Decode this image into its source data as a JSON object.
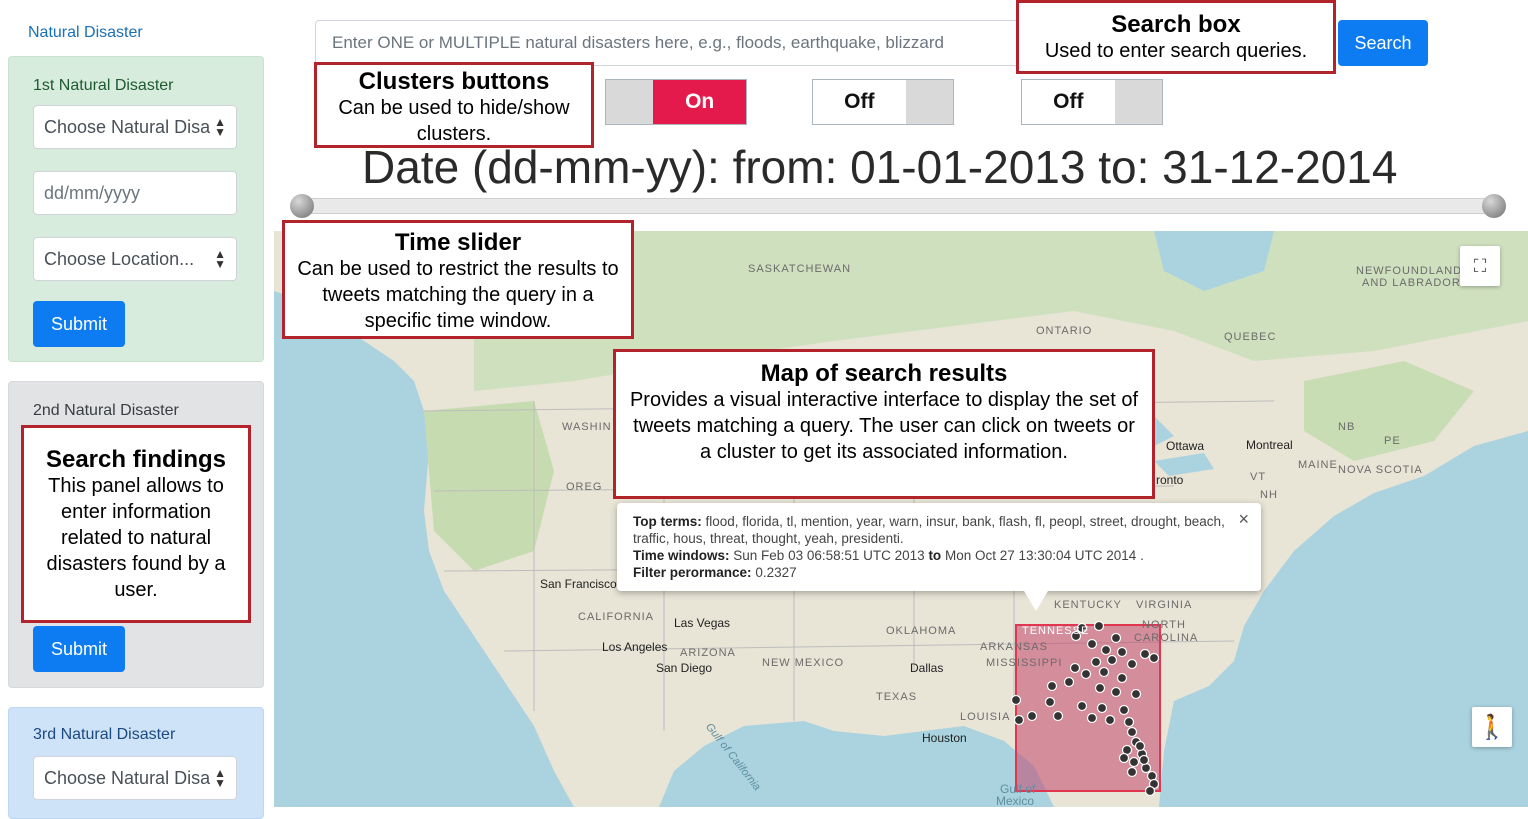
{
  "sidebar": {
    "title": "Natural Disaster",
    "panel1": {
      "title": "1st Natural Disaster",
      "disaster_select": "Choose Natural Disa",
      "date_placeholder": "dd/mm/yyyy",
      "location_select": "Choose Location...",
      "submit": "Submit"
    },
    "panel2": {
      "title": "2nd Natural Disaster",
      "submit": "Submit"
    },
    "panel3": {
      "title": "3rd Natural Disaster",
      "disaster_select": "Choose Natural Disa"
    }
  },
  "search": {
    "placeholder": "Enter ONE or MULTIPLE natural disasters here, e.g., floods, earthquake, blizzard",
    "button": "Search"
  },
  "toggles": [
    {
      "label": "On",
      "state": "on"
    },
    {
      "label": "Off",
      "state": "off"
    },
    {
      "label": "Off",
      "state": "off"
    }
  ],
  "date_range": {
    "text": "Date (dd-mm-yy): from: 01-01-2013 to: 31-12-2014"
  },
  "map": {
    "labels": {
      "saskatchewan": "SASKATCHEWAN",
      "newfoundland1": "NEWFOUNDLAND",
      "newfoundland2": "AND LABRADOR",
      "ontario": "ONTARIO",
      "quebec": "QUEBEC",
      "washington": "WASHIN",
      "oregon": "OREG",
      "ottawa": "Ottawa",
      "montreal": "Montreal",
      "nb": "NB",
      "pe": "PE",
      "maine": "MAINE",
      "vt": "VT",
      "nh": "NH",
      "nova_scotia": "NOVA SCOTIA",
      "toronto": "ronto",
      "san_francisco": "San Francisco",
      "california": "CALIFORNIA",
      "las_vegas": "Las Vegas",
      "los_angeles": "Los Angeles",
      "arizona": "ARIZONA",
      "san_diego": "San Diego",
      "new_mexico": "NEW MEXICO",
      "oklahoma": "OKLAHOMA",
      "dallas": "Dallas",
      "texas": "TEXAS",
      "houston": "Houston",
      "arkansas": "ARKANSAS",
      "mississippi": "MISSISSIPPI",
      "louisiana": "LOUISIA",
      "kentucky": "KENTUCKY",
      "virginia": "VIRGINIA",
      "tennessee": "TENNESSE",
      "north": "NORTH",
      "carolina": "CAROLINA",
      "gulf_california": "Gulf of California",
      "gulf_mexico1": "Gulf of",
      "gulf_mexico2": "Mexico"
    },
    "fullscreen_icon": "fullscreen-icon",
    "pegman_icon": "pegman-icon"
  },
  "info_window": {
    "top_terms_label": "Top terms:",
    "top_terms": "flood, florida, tl, mention, year, warn, insur, bank, flash, fl, peopl, street, drought, beach, traffic, hous, threat, thought, yeah, presidenti.",
    "time_label": "Time windows:",
    "time_from": "Sun Feb 03 06:58:51 UTC 2013",
    "time_to_word": "to",
    "time_to": "Mon Oct 27 13:30:04 UTC 2014 .",
    "filter_label": "Filter perormance:",
    "filter_value": "0.2327",
    "close": "×"
  },
  "annotations": {
    "search_box": {
      "title": "Search box",
      "desc": "Used to enter search queries."
    },
    "clusters": {
      "title": "Clusters buttons",
      "desc": "Can be used to hide/show clusters."
    },
    "time_slider": {
      "title": "Time slider",
      "desc": "Can be used to restrict the results to tweets matching the query in a specific time window."
    },
    "map_results": {
      "title": "Map of search results",
      "desc": "Provides a visual interactive interface to display the set of tweets matching a query. The user can click on tweets or a cluster to get its associated information."
    },
    "search_findings": {
      "title": "Search findings",
      "desc": "This panel allows to enter information related to natural disasters found by a user."
    }
  },
  "colors": {
    "accent_blue": "#0d7cf2",
    "toggle_on": "#e51a4c",
    "callout_border": "#b2232c",
    "cluster_fill": "#d0637f"
  }
}
